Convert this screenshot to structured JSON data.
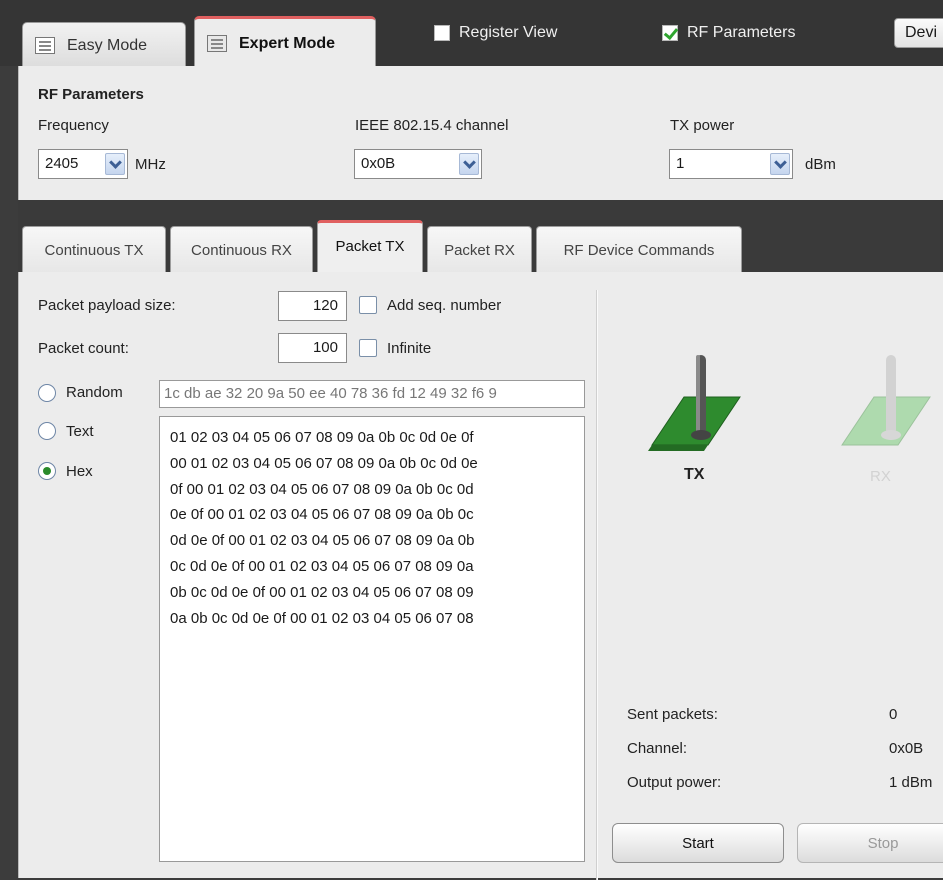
{
  "top_tabs": [
    {
      "label": "Easy Mode",
      "active": false
    },
    {
      "label": "Expert Mode",
      "active": true
    }
  ],
  "header": {
    "register_view": {
      "label": "Register View",
      "checked": false
    },
    "rf_parameters": {
      "label": "RF Parameters",
      "checked": true
    },
    "device_button": "Devi"
  },
  "rf": {
    "title": "RF Parameters",
    "frequency": {
      "label": "Frequency",
      "value": "2405",
      "unit": "MHz"
    },
    "channel": {
      "label": "IEEE 802.15.4 channel",
      "value": "0x0B"
    },
    "tx_power": {
      "label": "TX power",
      "value": "1",
      "unit": "dBm"
    }
  },
  "tabs": [
    {
      "label": "Continuous TX",
      "active": false
    },
    {
      "label": "Continuous RX",
      "active": false
    },
    {
      "label": "Packet TX",
      "active": true
    },
    {
      "label": "Packet RX",
      "active": false
    },
    {
      "label": "RF Device Commands",
      "active": false
    }
  ],
  "packet": {
    "payload_size": {
      "label": "Packet payload size:",
      "value": "120"
    },
    "add_seq": {
      "label": "Add seq. number",
      "checked": false
    },
    "count": {
      "label": "Packet count:",
      "value": "100"
    },
    "infinite": {
      "label": "Infinite",
      "checked": false
    },
    "modes": [
      {
        "label": "Random",
        "selected": false
      },
      {
        "label": "Text",
        "selected": false
      },
      {
        "label": "Hex",
        "selected": true
      }
    ],
    "random_value": "1c db ae 32 20 9a 50 ee 40 78 36 fd 12 49 32 f6 9",
    "hex_lines": [
      "01 02 03 04 05 06 07 08 09 0a 0b 0c 0d 0e 0f",
      "00 01 02 03 04 05 06 07 08 09 0a 0b 0c 0d 0e",
      "0f 00 01 02 03 04 05 06 07 08 09 0a 0b 0c 0d",
      "0e 0f 00 01 02 03 04 05 06 07 08 09 0a 0b 0c",
      "0d 0e 0f 00 01 02 03 04 05 06 07 08 09 0a 0b",
      "0c 0d 0e 0f 00 01 02 03 04 05 06 07 08 09 0a",
      "0b 0c 0d 0e 0f 00 01 02 03 04 05 06 07 08 09",
      "0a 0b 0c 0d 0e 0f 00 01 02 03 04 05 06 07 08"
    ]
  },
  "radio_switch": {
    "tx_label": "TX",
    "rx_label": "RX",
    "active": "TX",
    "active_color": "#2e8b2e",
    "inactive_color": "#a8d8a8"
  },
  "stats": [
    {
      "label": "Sent packets:",
      "value": "0"
    },
    {
      "label": "Channel:",
      "value": "0x0B"
    },
    {
      "label": "Output power:",
      "value": "1 dBm"
    }
  ],
  "buttons": {
    "start": "Start",
    "stop": "Stop"
  }
}
